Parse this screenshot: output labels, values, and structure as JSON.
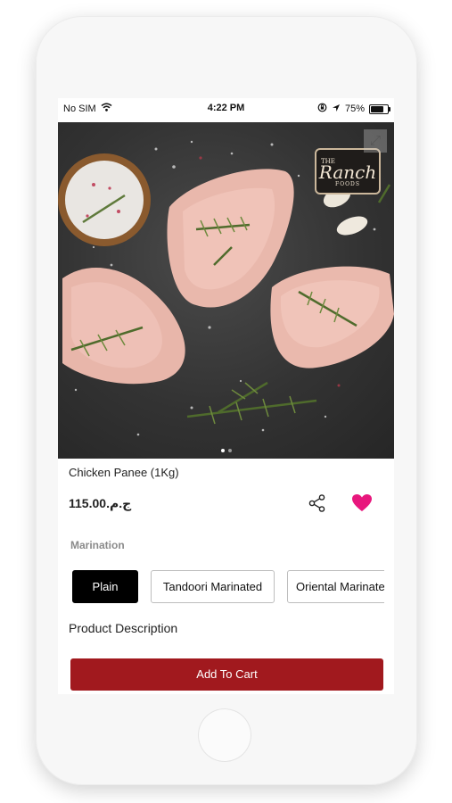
{
  "status_bar": {
    "carrier": "No SIM",
    "time": "4:22 PM",
    "battery": "75%",
    "battery_level": 0.75
  },
  "hero": {
    "logo": {
      "the": "THE",
      "name": "Ranch",
      "foods": "FOODS"
    },
    "carousel_pages": 2,
    "active_page": 1
  },
  "product": {
    "name": "Chicken Panee (1Kg)",
    "price": "ج.م.115.00"
  },
  "marination": {
    "label": "Marination",
    "options": [
      "Plain",
      "Tandoori Marinated",
      "Oriental Marinated"
    ],
    "selected": "Plain"
  },
  "description": {
    "title": "Product Description"
  },
  "cart": {
    "button_label": "Add To Cart"
  },
  "colors": {
    "accent": "#a1191e",
    "heart": "#e8177d",
    "selected_option": "#000000"
  },
  "icons": {
    "wifi": "wifi-icon",
    "lock_rotation": "rotation-lock-icon",
    "location": "location-arrow-icon",
    "battery": "battery-icon",
    "expand": "expand-icon",
    "share": "share-icon",
    "favorite": "heart-icon"
  }
}
